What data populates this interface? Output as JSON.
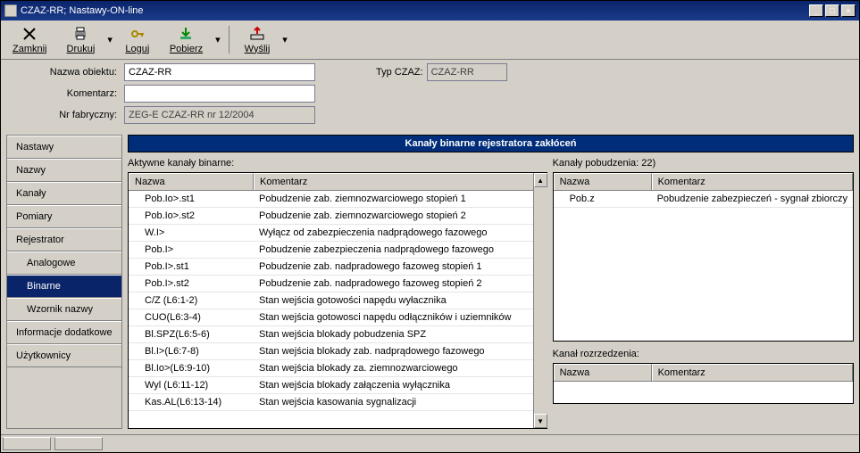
{
  "window": {
    "title": "CZAZ-RR; Nastawy-ON-line"
  },
  "toolbar": {
    "zamknij": "Zamknij",
    "drukuj": "Drukuj",
    "loguj": "Loguj",
    "pobierz": "Pobierz",
    "wyslij": "Wyślij"
  },
  "form": {
    "nazwaObiektuLabel": "Nazwa obiektu:",
    "nazwaObiektu": "CZAZ-RR",
    "typCzazLabel": "Typ CZAZ:",
    "typCzaz": "CZAZ-RR",
    "komentarzLabel": "Komentarz:",
    "komentarz": "",
    "nrFabrycznyLabel": "Nr fabryczny:",
    "nrFabryczny": "ZEG-E CZAZ-RR nr 12/2004"
  },
  "nav": {
    "items": [
      "Nastawy",
      "Nazwy",
      "Kanały",
      "Pomiary",
      "Rejestrator",
      "Analogowe",
      "Binarne",
      "Wzornik nazwy",
      "Informacje dodatkowe",
      "Użytkownicy"
    ],
    "subIndexes": [
      5,
      6,
      7
    ],
    "selected": 6
  },
  "content": {
    "header": "Kanały binarne rejestratora zakłóceń",
    "leftLabel": "Aktywne kanały binarne:",
    "leftCols": {
      "c1": "Nazwa",
      "c2": "Komentarz"
    },
    "leftRows": [
      {
        "n": "Pob.Io>.st1",
        "k": "Pobudzenie zab. ziemnozwarciowego stopień 1"
      },
      {
        "n": "Pob.Io>.st2",
        "k": "Pobudzenie zab. ziemnozwarciowego stopień 2"
      },
      {
        "n": "W.I>",
        "k": "Wyłącz od zabezpieczenia nadprądowego fazowego"
      },
      {
        "n": "Pob.I>",
        "k": "Pobudzenie zabezpieczenia nadprądowego fazowego"
      },
      {
        "n": "Pob.I>.st1",
        "k": "Pobudzenie zab. nadpradowego fazoweg stopień 1"
      },
      {
        "n": "Pob.I>.st2",
        "k": "Pobudzenie zab. nadpradowego fazoweg stopień 2"
      },
      {
        "n": "C/Z (L6:1-2)",
        "k": "Stan wejścia gotowości napędu wyłacznika"
      },
      {
        "n": "CUO(L6:3-4)",
        "k": "Stan wejścia gotowosci napędu odłączników i uziemników"
      },
      {
        "n": "Bl.SPZ(L6:5-6)",
        "k": "Stan wejścia blokady pobudzenia SPZ"
      },
      {
        "n": "Bl.I>(L6:7-8)",
        "k": "Stan wejścia blokady zab. nadprądowego fazowego"
      },
      {
        "n": "Bl.Io>(L6:9-10)",
        "k": "Stan wejścia blokady za. ziemnozwarciowego"
      },
      {
        "n": "Wyl (L6:11-12)",
        "k": "Stan wejścia blokady załączenia wyłącznika"
      },
      {
        "n": "Kas.AL(L6:13-14)",
        "k": "Stan wejścia kasowania sygnalizacji"
      }
    ],
    "rightLabel": "Kanały pobudzenia: 22)",
    "rightCols": {
      "c1": "Nazwa",
      "c2": "Komentarz"
    },
    "rightRows": [
      {
        "n": "Pob.z",
        "k": "Pobudzenie zabezpieczeń - sygnał zbiorczy"
      }
    ],
    "rozLabel": "Kanał rozrzedzenia:",
    "rozCols": {
      "c1": "Nazwa",
      "c2": "Komentarz"
    }
  }
}
